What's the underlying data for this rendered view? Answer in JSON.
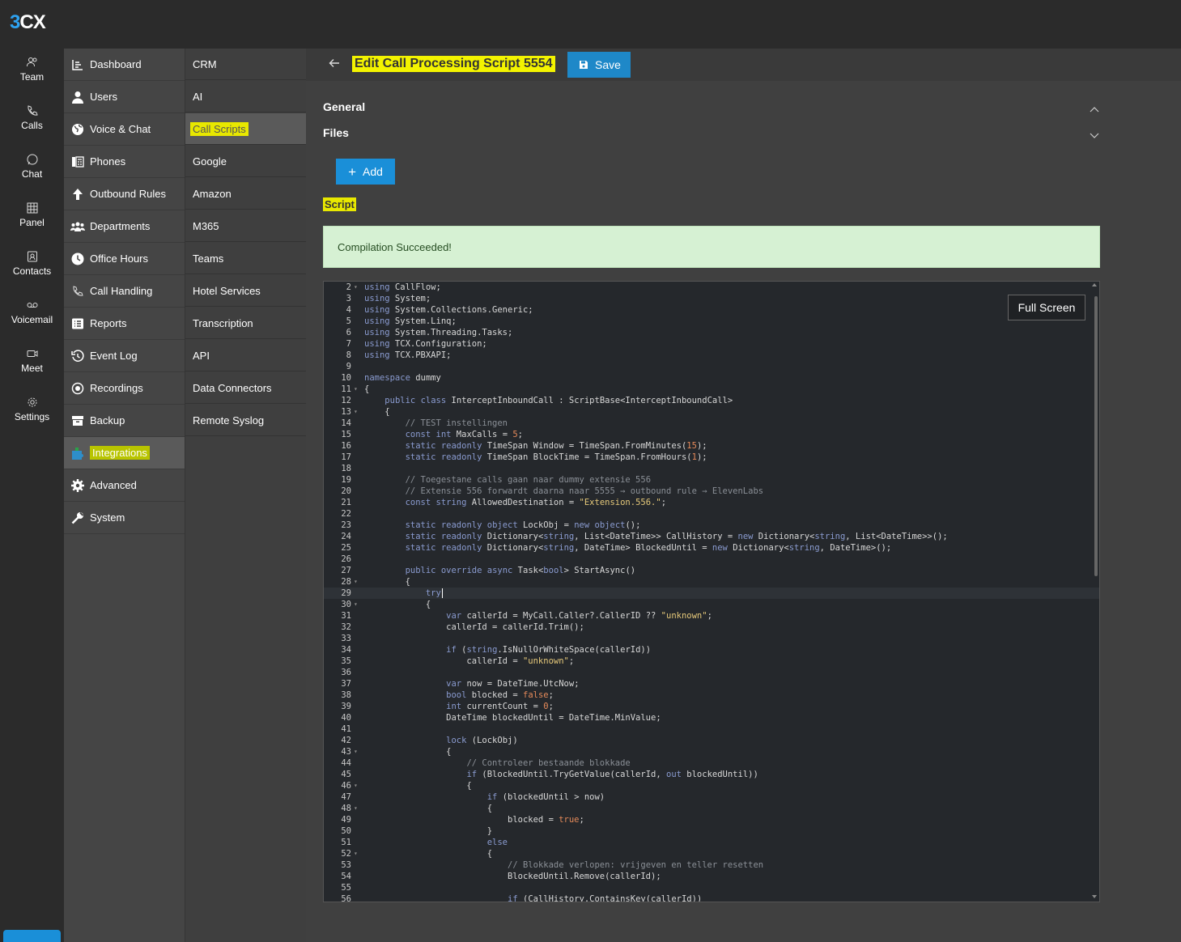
{
  "app": {
    "logo_three": "3",
    "logo_cx": "CX"
  },
  "rail": [
    {
      "label": "Team",
      "icon": "team-icon"
    },
    {
      "label": "Calls",
      "icon": "phone-icon"
    },
    {
      "label": "Chat",
      "icon": "chat-icon"
    },
    {
      "label": "Panel",
      "icon": "grid-icon"
    },
    {
      "label": "Contacts",
      "icon": "contact-card-icon"
    },
    {
      "label": "Voicemail",
      "icon": "voicemail-icon"
    },
    {
      "label": "Meet",
      "icon": "video-icon"
    },
    {
      "label": "Settings",
      "icon": "gear-icon"
    }
  ],
  "menu1": [
    {
      "label": "Dashboard",
      "icon": "dashboard-icon"
    },
    {
      "label": "Users",
      "icon": "user-icon"
    },
    {
      "label": "Voice & Chat",
      "icon": "globe-icon"
    },
    {
      "label": "Phones",
      "icon": "phones-icon"
    },
    {
      "label": "Outbound Rules",
      "icon": "arrow-up-icon"
    },
    {
      "label": "Departments",
      "icon": "group-icon"
    },
    {
      "label": "Office Hours",
      "icon": "clock-icon"
    },
    {
      "label": "Call Handling",
      "icon": "phone-icon"
    },
    {
      "label": "Reports",
      "icon": "list-icon"
    },
    {
      "label": "Event Log",
      "icon": "history-icon"
    },
    {
      "label": "Recordings",
      "icon": "record-icon"
    },
    {
      "label": "Backup",
      "icon": "archive-icon"
    },
    {
      "label": "Integrations",
      "icon": "puzzle-icon"
    },
    {
      "label": "Advanced",
      "icon": "cog-icon"
    },
    {
      "label": "System",
      "icon": "wrench-icon"
    }
  ],
  "menu2": [
    "CRM",
    "AI",
    "Call Scripts",
    "Google",
    "Amazon",
    "M365",
    "Teams",
    "Hotel Services",
    "Transcription",
    "API",
    "Data Connectors",
    "Remote Syslog"
  ],
  "header": {
    "title": "Edit Call Processing Script 5554",
    "save_label": "Save"
  },
  "sections": {
    "general": "General",
    "files": "Files",
    "add_label": "Add",
    "script": "Script"
  },
  "status": {
    "message": "Compilation Succeeded!"
  },
  "editor": {
    "fullscreen_label": "Full Screen",
    "lines": [
      {
        "n": "2",
        "f": true,
        "t": "using CallFlow;"
      },
      {
        "n": "3",
        "t": "using System;"
      },
      {
        "n": "4",
        "t": "using System.Collections.Generic;"
      },
      {
        "n": "5",
        "t": "using System.Linq;"
      },
      {
        "n": "6",
        "t": "using System.Threading.Tasks;"
      },
      {
        "n": "7",
        "t": "using TCX.Configuration;"
      },
      {
        "n": "8",
        "t": "using TCX.PBXAPI;"
      },
      {
        "n": "9",
        "t": ""
      },
      {
        "n": "10",
        "t": "namespace dummy"
      },
      {
        "n": "11",
        "f": true,
        "t": "{"
      },
      {
        "n": "12",
        "t": "    public class InterceptInboundCall : ScriptBase<InterceptInboundCall>"
      },
      {
        "n": "13",
        "f": true,
        "t": "    {"
      },
      {
        "n": "14",
        "t": "        // TEST instellingen"
      },
      {
        "n": "15",
        "t": "        const int MaxCalls = 5;"
      },
      {
        "n": "16",
        "t": "        static readonly TimeSpan Window = TimeSpan.FromMinutes(15);"
      },
      {
        "n": "17",
        "t": "        static readonly TimeSpan BlockTime = TimeSpan.FromHours(1);"
      },
      {
        "n": "18",
        "t": ""
      },
      {
        "n": "19",
        "t": "        // Toegestane calls gaan naar dummy extensie 556"
      },
      {
        "n": "20",
        "t": "        // Extensie 556 forwardt daarna naar 5555 → outbound rule → ElevenLabs"
      },
      {
        "n": "21",
        "t": "        const string AllowedDestination = \"Extension.556.\";"
      },
      {
        "n": "22",
        "t": ""
      },
      {
        "n": "23",
        "t": "        static readonly object LockObj = new object();"
      },
      {
        "n": "24",
        "t": "        static readonly Dictionary<string, List<DateTime>> CallHistory = new Dictionary<string, List<DateTime>>();"
      },
      {
        "n": "25",
        "t": "        static readonly Dictionary<string, DateTime> BlockedUntil = new Dictionary<string, DateTime>();"
      },
      {
        "n": "26",
        "t": ""
      },
      {
        "n": "27",
        "t": "        public override async Task<bool> StartAsync()"
      },
      {
        "n": "28",
        "f": true,
        "t": "        {"
      },
      {
        "n": "29",
        "t": "            try",
        "active": true
      },
      {
        "n": "30",
        "f": true,
        "t": "            {"
      },
      {
        "n": "31",
        "t": "                var callerId = MyCall.Caller?.CallerID ?? \"unknown\";"
      },
      {
        "n": "32",
        "t": "                callerId = callerId.Trim();"
      },
      {
        "n": "33",
        "t": ""
      },
      {
        "n": "34",
        "t": "                if (string.IsNullOrWhiteSpace(callerId))"
      },
      {
        "n": "35",
        "t": "                    callerId = \"unknown\";"
      },
      {
        "n": "36",
        "t": ""
      },
      {
        "n": "37",
        "t": "                var now = DateTime.UtcNow;"
      },
      {
        "n": "38",
        "t": "                bool blocked = false;"
      },
      {
        "n": "39",
        "t": "                int currentCount = 0;"
      },
      {
        "n": "40",
        "t": "                DateTime blockedUntil = DateTime.MinValue;"
      },
      {
        "n": "41",
        "t": ""
      },
      {
        "n": "42",
        "t": "                lock (LockObj)"
      },
      {
        "n": "43",
        "f": true,
        "t": "                {"
      },
      {
        "n": "44",
        "t": "                    // Controleer bestaande blokkade"
      },
      {
        "n": "45",
        "t": "                    if (BlockedUntil.TryGetValue(callerId, out blockedUntil))"
      },
      {
        "n": "46",
        "f": true,
        "t": "                    {"
      },
      {
        "n": "47",
        "t": "                        if (blockedUntil > now)"
      },
      {
        "n": "48",
        "f": true,
        "t": "                        {"
      },
      {
        "n": "49",
        "t": "                            blocked = true;"
      },
      {
        "n": "50",
        "t": "                        }"
      },
      {
        "n": "51",
        "t": "                        else"
      },
      {
        "n": "52",
        "f": true,
        "t": "                        {"
      },
      {
        "n": "53",
        "t": "                            // Blokkade verlopen: vrijgeven en teller resetten"
      },
      {
        "n": "54",
        "t": "                            BlockedUntil.Remove(callerId);"
      },
      {
        "n": "55",
        "t": ""
      },
      {
        "n": "56",
        "t": "                            if (CallHistory.ContainsKey(callerId))"
      }
    ]
  },
  "colors": {
    "accent": "#1a8fd8",
    "highlight": "#f3f300",
    "success_bg": "#d6f1d3"
  }
}
